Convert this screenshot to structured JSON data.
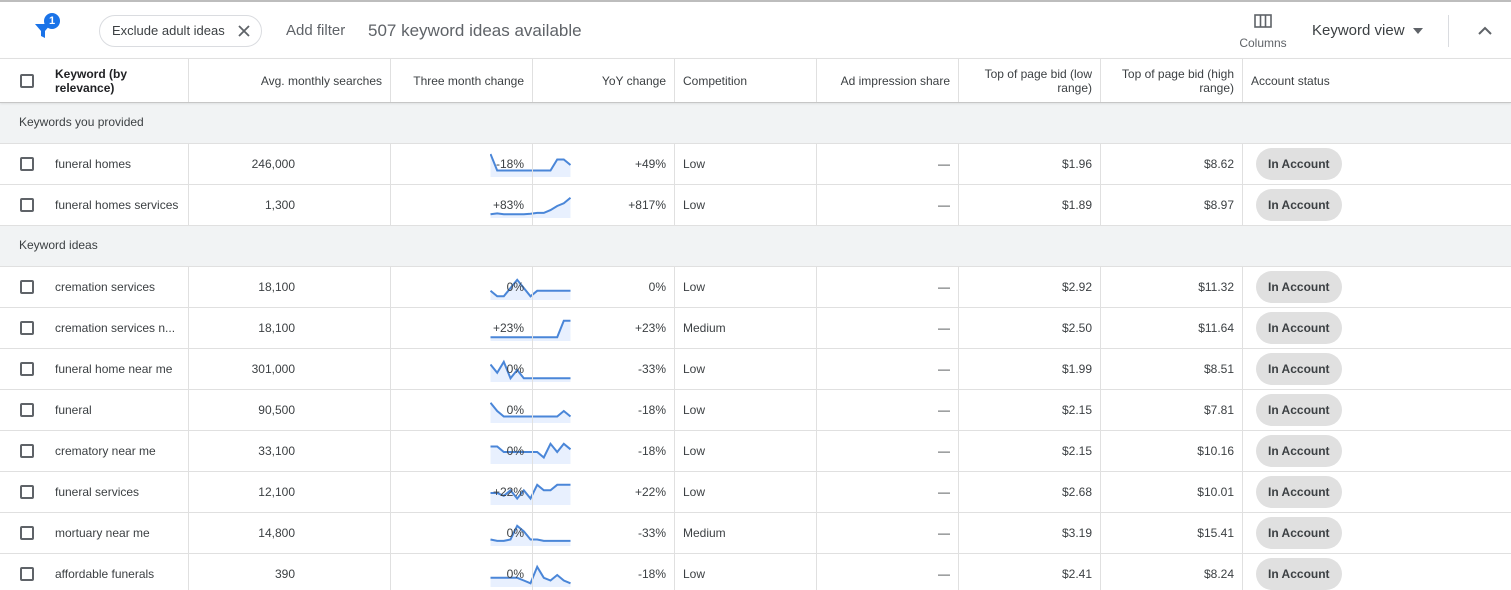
{
  "toolbar": {
    "filter_badge": "1",
    "chip_label": "Exclude adult ideas",
    "add_filter": "Add filter",
    "ideas_count": "507 keyword ideas available",
    "columns_label": "Columns",
    "view_label": "Keyword view"
  },
  "columns": {
    "keyword": "Keyword (by relevance)",
    "searches": "Avg. monthly searches",
    "three_month": "Three month change",
    "yoy": "YoY change",
    "competition": "Competition",
    "impression": "Ad impression share",
    "bid_low": "Top of page bid (low range)",
    "bid_high": "Top of page bid (high range)",
    "status": "Account status"
  },
  "groups": {
    "provided": "Keywords you provided",
    "ideas": "Keyword ideas"
  },
  "rows": [
    {
      "keyword": "funeral homes",
      "searches": "246,000",
      "three_month": "-18%",
      "yoy": "+49%",
      "competition": "Low",
      "impression": "—",
      "bid_low": "$1.96",
      "bid_high": "$8.62",
      "status": "In Account",
      "trend": [
        8,
        2,
        2,
        2,
        2,
        2,
        2,
        2,
        2,
        2,
        6,
        6,
        4
      ]
    },
    {
      "keyword": "funeral homes services",
      "searches": "1,300",
      "three_month": "+83%",
      "yoy": "+817%",
      "competition": "Low",
      "impression": "—",
      "bid_low": "$1.89",
      "bid_high": "$8.97",
      "status": "In Account",
      "trend": [
        1,
        1.3,
        1,
        1,
        1,
        1,
        1.2,
        1.5,
        1.5,
        2.5,
        4,
        5,
        7
      ]
    },
    {
      "keyword": "cremation services",
      "searches": "18,100",
      "three_month": "0%",
      "yoy": "0%",
      "competition": "Low",
      "impression": "—",
      "bid_low": "$2.92",
      "bid_high": "$11.32",
      "status": "In Account",
      "trend": [
        3,
        1,
        1,
        4,
        7,
        4,
        1,
        3,
        3,
        3,
        3,
        3,
        3
      ]
    },
    {
      "keyword": "cremation services n...",
      "searches": "18,100",
      "three_month": "+23%",
      "yoy": "+23%",
      "competition": "Medium",
      "impression": "—",
      "bid_low": "$2.50",
      "bid_high": "$11.64",
      "status": "In Account",
      "trend": [
        1,
        1,
        1,
        1,
        1,
        1,
        1,
        1,
        1,
        1,
        1,
        7,
        7
      ]
    },
    {
      "keyword": "funeral home near me",
      "searches": "301,000",
      "three_month": "0%",
      "yoy": "-33%",
      "competition": "Low",
      "impression": "—",
      "bid_low": "$1.99",
      "bid_high": "$8.51",
      "status": "In Account",
      "trend": [
        6,
        3,
        7,
        1,
        4,
        1,
        1,
        1,
        1,
        1,
        1,
        1,
        1
      ]
    },
    {
      "keyword": "funeral",
      "searches": "90,500",
      "three_month": "0%",
      "yoy": "-18%",
      "competition": "Low",
      "impression": "—",
      "bid_low": "$2.15",
      "bid_high": "$7.81",
      "status": "In Account",
      "trend": [
        7,
        4,
        2,
        2,
        2,
        2,
        2,
        2,
        2,
        2,
        2,
        4,
        2
      ]
    },
    {
      "keyword": "crematory near me",
      "searches": "33,100",
      "three_month": "0%",
      "yoy": "-18%",
      "competition": "Low",
      "impression": "—",
      "bid_low": "$2.15",
      "bid_high": "$10.16",
      "status": "In Account",
      "trend": [
        6,
        6,
        4,
        4,
        4,
        4,
        4,
        4,
        2,
        7,
        4,
        7,
        5
      ]
    },
    {
      "keyword": "funeral services",
      "searches": "12,100",
      "three_month": "+22%",
      "yoy": "+22%",
      "competition": "Low",
      "impression": "—",
      "bid_low": "$2.68",
      "bid_high": "$10.01",
      "status": "In Account",
      "trend": [
        4,
        4,
        3,
        5,
        2,
        5,
        2,
        7,
        5,
        5,
        7,
        7,
        7
      ]
    },
    {
      "keyword": "mortuary near me",
      "searches": "14,800",
      "three_month": "0%",
      "yoy": "-33%",
      "competition": "Medium",
      "impression": "—",
      "bid_low": "$3.19",
      "bid_high": "$15.41",
      "status": "In Account",
      "trend": [
        2,
        1.5,
        1.5,
        2,
        7,
        5,
        2,
        2,
        1.5,
        1.5,
        1.5,
        1.5,
        1.5
      ]
    },
    {
      "keyword": "affordable funerals",
      "searches": "390",
      "three_month": "0%",
      "yoy": "-18%",
      "competition": "Low",
      "impression": "—",
      "bid_low": "$2.41",
      "bid_high": "$8.24",
      "status": "In Account",
      "trend": [
        3,
        3,
        3,
        3,
        3,
        2,
        1,
        7,
        3,
        2,
        4,
        2,
        1
      ]
    }
  ],
  "colors": {
    "accent": "#1a73e8",
    "sparkline": "#4a86d8",
    "sparkline_fill": "#e8f0fe",
    "badge_bg": "#e0e0e0",
    "group_bg": "#f1f3f4"
  }
}
